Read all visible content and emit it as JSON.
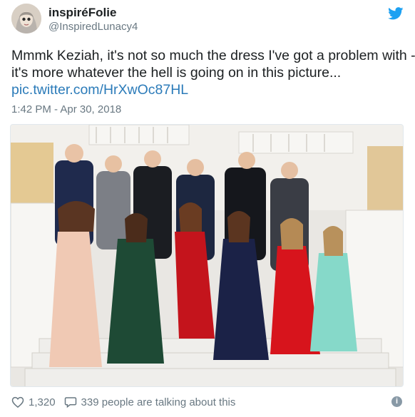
{
  "author": {
    "display_name": "inspiréFolie",
    "handle": "@InspiredLunacy4",
    "avatar_icon": "avatar-illustration"
  },
  "tweet": {
    "text_line1": "Mmmk Keziah, it's not so much the dress I've got a problem with -",
    "text_line2": "it's more whatever the hell is going on in this picture...",
    "link": "pic.twitter.com/HrXwOc87HL",
    "timestamp": "1:42 PM - Apr 30, 2018"
  },
  "footer": {
    "likes": "1,320",
    "replies_text": "339 people are talking about this"
  },
  "colors": {
    "brand_blue": "#1da1f2",
    "link": "#2b7bb9",
    "secondary_text": "#697882"
  },
  "icons": [
    "twitter-bird-icon",
    "heart-icon",
    "speech-bubble-icon",
    "info-icon"
  ]
}
